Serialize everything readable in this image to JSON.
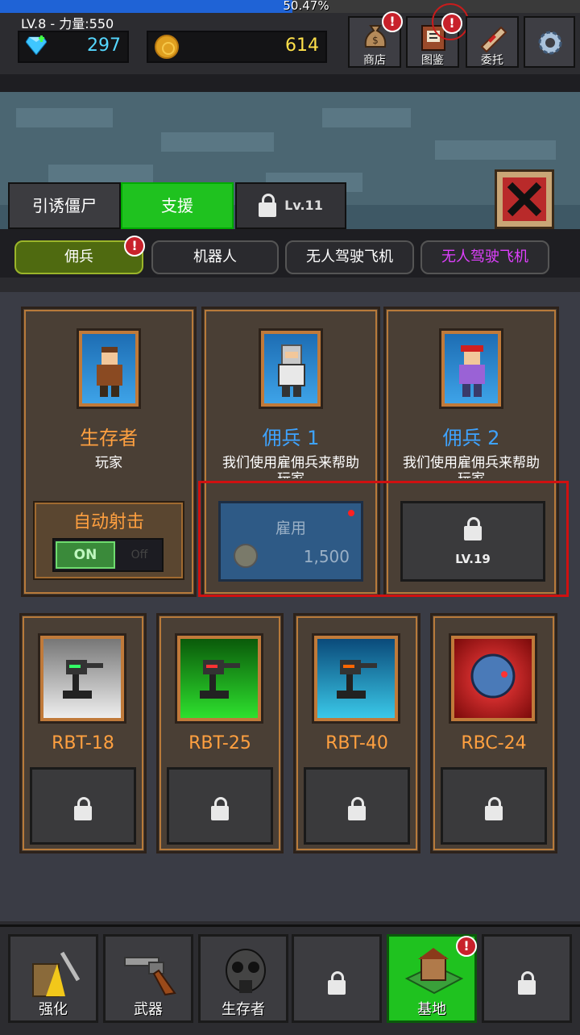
{
  "top": {
    "xp_percent": 50.47,
    "xp_text": "50.47%",
    "level_power": "LV.8 - 力量:550",
    "gems": "297",
    "coins": "614",
    "buttons": [
      {
        "label": "商店",
        "icon": "money-bag-icon",
        "alert": true
      },
      {
        "label": "图鉴",
        "icon": "book-icon",
        "alert": true
      },
      {
        "label": "委托",
        "icon": "scroll-icon",
        "alert": false
      },
      {
        "label": "",
        "icon": "gear-icon",
        "alert": false
      }
    ]
  },
  "tabs": {
    "lure": "引诱僵尸",
    "support": "支援",
    "locked": "Lv.11"
  },
  "subtabs": {
    "merc": "佣兵",
    "robot": "机器人",
    "drone1": "无人驾驶飞机",
    "drone2": "无人驾驶飞机"
  },
  "cards": {
    "survivor": {
      "name": "生存者",
      "desc": "玩家",
      "auto_fire_label": "自动射击",
      "on": "ON",
      "off": "Off"
    },
    "merc1": {
      "name": "佣兵 1",
      "desc": "我们使用雇佣兵来帮助",
      "desc2": "玩家",
      "hire_label": "雇用",
      "price": "1,500"
    },
    "merc2": {
      "name": "佣兵 2",
      "desc": "我们使用雇佣兵来帮助",
      "desc2": "玩家",
      "lock_level": "LV.19"
    }
  },
  "robots": [
    "RBT-18",
    "RBT-25",
    "RBT-40",
    "RBC-24"
  ],
  "nav": {
    "upgrade": "强化",
    "weapon": "武器",
    "survivor": "生存者",
    "base": "基地"
  },
  "colors": {
    "accent_green": "#1fc21f",
    "merc_name_blue": "#3ea3ff",
    "survivor_orange": "#ffa040",
    "alert_red": "#c8212b"
  }
}
